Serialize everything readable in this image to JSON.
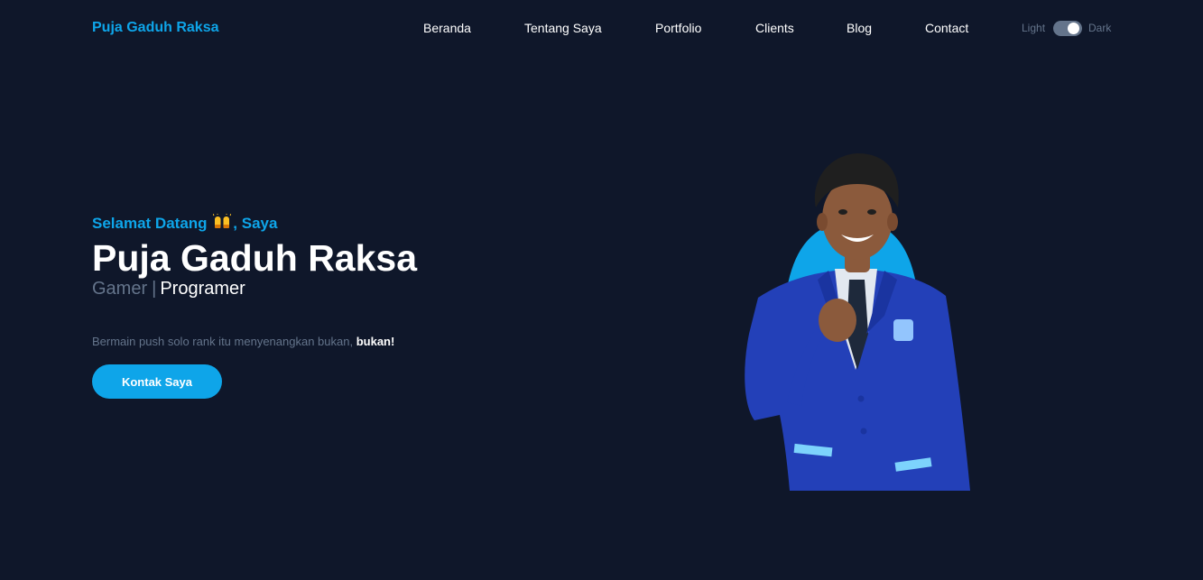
{
  "nav": {
    "brand": "Puja Gaduh Raksa",
    "links": [
      "Beranda",
      "Tentang Saya",
      "Portfolio",
      "Clients",
      "Blog",
      "Contact"
    ],
    "theme_toggle": {
      "light_label": "Light",
      "dark_label": "Dark",
      "state": "dark"
    }
  },
  "hero": {
    "greeting_prefix": "Selamat Datang",
    "greeting_emoji": "raising-hands-icon",
    "greeting_suffix": ", Saya",
    "name": "Puja Gaduh Raksa",
    "role_secondary": "Gamer",
    "role_separator": "|",
    "role_primary": "Programer",
    "tagline": "Bermain push solo rank itu menyenangkan bukan,",
    "tagline_emphasis": "bukan!",
    "cta_label": "Kontak Saya"
  },
  "colors": {
    "background": "#0f172a",
    "accent": "#0ea5e9",
    "muted_text": "#64748b",
    "text": "#ffffff",
    "blazer": "#2340b8"
  }
}
